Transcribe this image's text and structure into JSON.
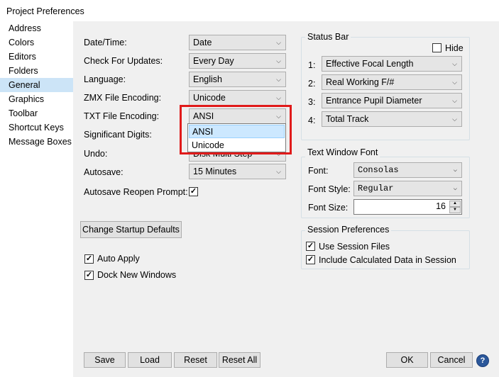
{
  "window": {
    "title": "Project Preferences"
  },
  "sidebar": {
    "items": [
      {
        "label": "Address"
      },
      {
        "label": "Colors"
      },
      {
        "label": "Editors"
      },
      {
        "label": "Folders"
      },
      {
        "label": "General"
      },
      {
        "label": "Graphics"
      },
      {
        "label": "Toolbar"
      },
      {
        "label": "Shortcut Keys"
      },
      {
        "label": "Message Boxes"
      }
    ],
    "selected": "General"
  },
  "general": {
    "date_time": {
      "label": "Date/Time:",
      "value": "Date"
    },
    "check_updates": {
      "label": "Check For Updates:",
      "value": "Every Day"
    },
    "language": {
      "label": "Language:",
      "value": "English"
    },
    "zmx_encoding": {
      "label": "ZMX File Encoding:",
      "value": "Unicode"
    },
    "txt_encoding": {
      "label": "TXT File Encoding:",
      "value": "ANSI",
      "options": [
        "ANSI",
        "Unicode"
      ]
    },
    "significant_digits": {
      "label": "Significant Digits:"
    },
    "undo": {
      "label": "Undo:",
      "value": "Disk Multi Step"
    },
    "autosave": {
      "label": "Autosave:",
      "value": "15 Minutes"
    },
    "autosave_reopen": {
      "label": "Autosave Reopen Prompt:",
      "checked": true
    },
    "change_startup": "Change Startup Defaults",
    "auto_apply": {
      "label": "Auto Apply",
      "checked": true
    },
    "dock_new": {
      "label": "Dock New Windows",
      "checked": true
    }
  },
  "status_bar": {
    "title": "Status Bar",
    "hide": {
      "label": "Hide",
      "checked": false
    },
    "rows": [
      {
        "num": "1:",
        "value": "Effective Focal Length"
      },
      {
        "num": "2:",
        "value": "Real Working F/#"
      },
      {
        "num": "3:",
        "value": "Entrance Pupil Diameter"
      },
      {
        "num": "4:",
        "value": "Total Track"
      }
    ]
  },
  "text_font": {
    "title": "Text Window Font",
    "font": {
      "label": "Font:",
      "value": "Consolas"
    },
    "style": {
      "label": "Font Style:",
      "value": "Regular"
    },
    "size": {
      "label": "Font Size:",
      "value": "16"
    }
  },
  "session": {
    "title": "Session Preferences",
    "use_session": {
      "label": "Use Session Files",
      "checked": true
    },
    "include_calc": {
      "label": "Include Calculated Data in Session",
      "checked": true
    }
  },
  "footer": {
    "save": "Save",
    "load": "Load",
    "reset": "Reset",
    "reset_all": "Reset All",
    "ok": "OK",
    "cancel": "Cancel",
    "help": "?"
  }
}
